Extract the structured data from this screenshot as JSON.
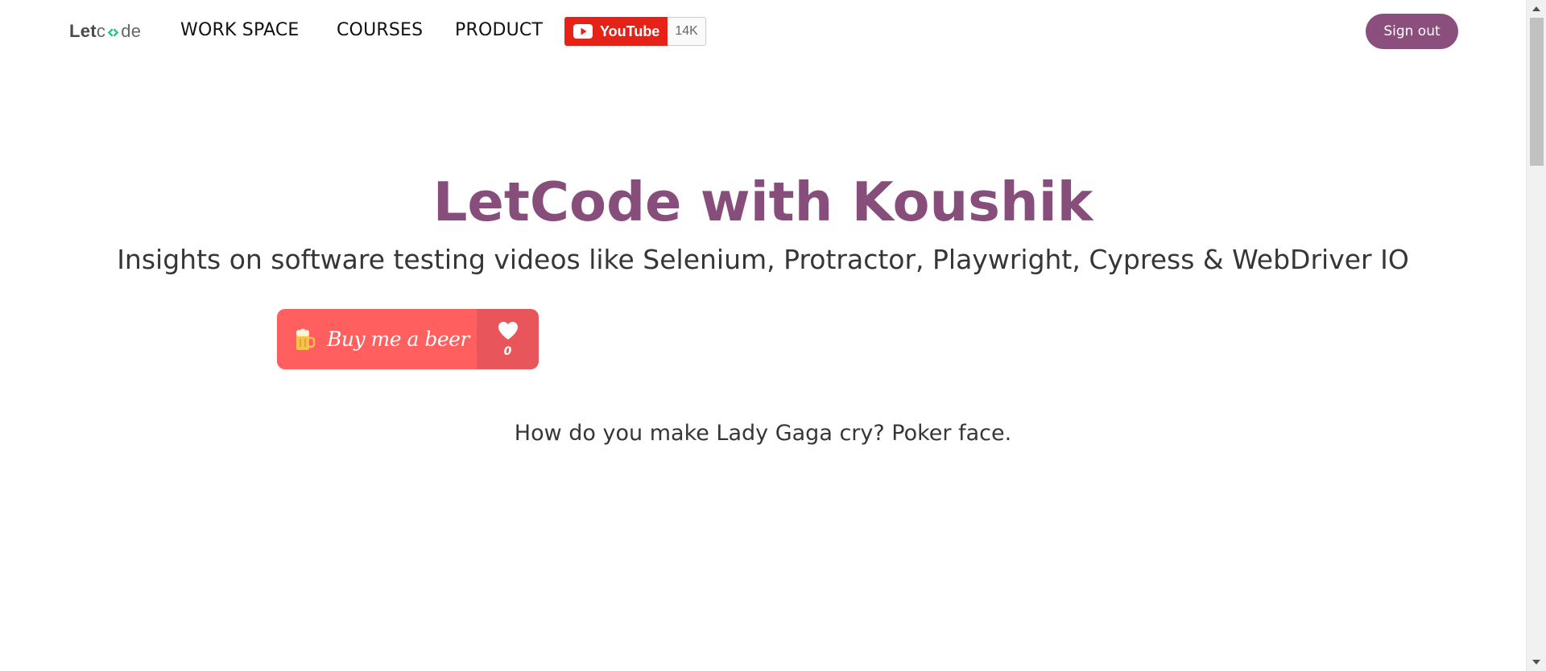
{
  "nav": {
    "brand": {
      "prefix": "Let",
      "suffix": "de",
      "logo_icon": "code-brackets-icon"
    },
    "items": [
      {
        "label": "WORK SPACE"
      },
      {
        "label": "COURSES"
      },
      {
        "label": "PRODUCT"
      }
    ],
    "youtube": {
      "label": "YouTube",
      "count": "14K",
      "icon": "youtube-play-icon",
      "color": "#e62117"
    },
    "signout_label": "Sign out"
  },
  "hero": {
    "title": "LetCode with Koushik",
    "subtitle": "Insights on software testing videos like Selenium, Protractor, Playwright, Cypress & WebDriver IO"
  },
  "buy_me_a_beer": {
    "label": "Buy me a beer",
    "count": "0",
    "icon": "beer-mug-icon",
    "like_icon": "heart-icon"
  },
  "joke": "How do you make Lady Gaga cry? Poker face.",
  "colors": {
    "accent": "#8b4f7d",
    "title": "#874e7b",
    "beer_main": "#ff5f5f",
    "beer_side": "#e8555a"
  }
}
